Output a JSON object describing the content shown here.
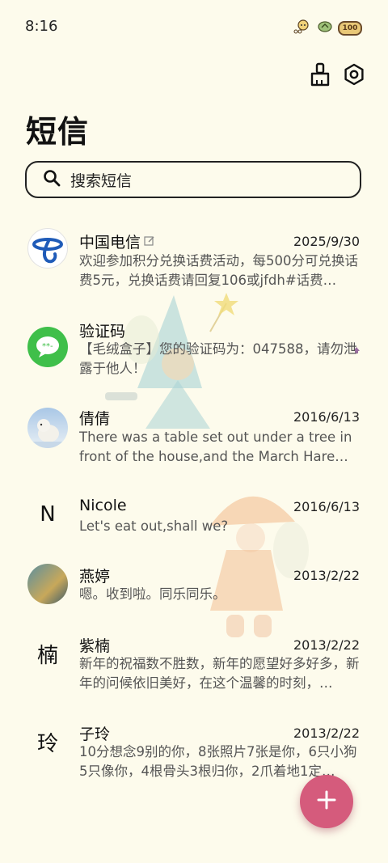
{
  "status_bar": {
    "time": "8:16",
    "battery": "100",
    "icons": [
      "character-badge-icon",
      "signal-leaf-icon",
      "battery-icon"
    ]
  },
  "toolbar": {
    "clean_icon": "broom-icon",
    "settings_icon": "settings-hexagon-icon"
  },
  "page": {
    "title": "短信"
  },
  "search": {
    "placeholder": "搜索短信"
  },
  "conversations": [
    {
      "name": "中国电信",
      "date": "2025/9/30",
      "preview": "欢迎参加积分兑换话费活动，每500分可兑换话费5元，兑换话费请回复106或jfdh#话费…",
      "avatar": "china-telecom-logo",
      "has_draft_icon": true
    },
    {
      "name": "验证码",
      "date": "",
      "preview": "【毛绒盒子】您的验证码为：047588，请勿泄露于他人！",
      "avatar": "message-bubble-avatar"
    },
    {
      "name": "倩倩",
      "date": "2016/6/13",
      "preview": "There was a table set out under a tree in front of the house,and the March Hare an…",
      "avatar": "polar-bear-photo"
    },
    {
      "name": "Nicole",
      "date": "2016/6/13",
      "preview": "Let's eat out,shall we?",
      "avatar_letter": "N"
    },
    {
      "name": "燕婷",
      "date": "2013/2/22",
      "preview": "嗯。收到啦。同乐同乐。",
      "avatar": "landscape-photo"
    },
    {
      "name": "紫楠",
      "date": "2013/2/22",
      "preview": "新年的祝福数不胜数，新年的愿望好多好多，新年的问候依旧美好，在这个温馨的时刻，…",
      "avatar_letter": "楠"
    },
    {
      "name": "子玲",
      "date": "2013/2/22",
      "preview": "10分想念9别的你，8张照片7张是你，6只小狗5只像你，4根骨头3根归你，2爪着地1定…",
      "avatar_letter": "玲"
    }
  ],
  "fab": {
    "icon": "plus-icon"
  },
  "colors": {
    "background": "#fdfbec",
    "fab": "#d55b7c",
    "accent_green": "#3fbf4a",
    "telecom_blue": "#1f5bb8"
  }
}
